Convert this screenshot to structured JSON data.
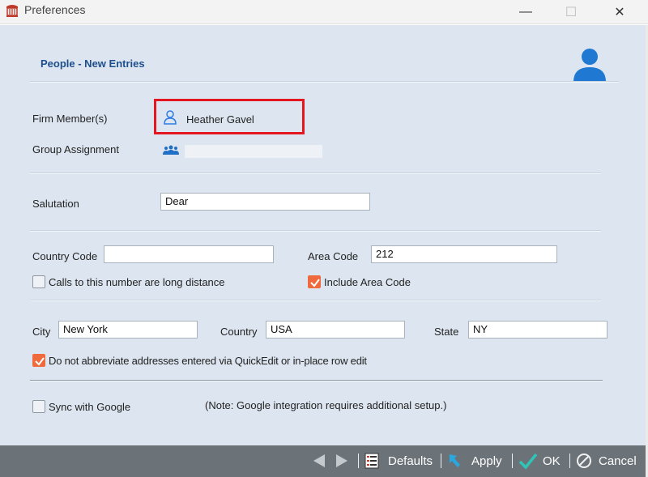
{
  "window": {
    "title": "Preferences",
    "minimize": "—",
    "maximize": "☐",
    "close": "✕"
  },
  "section": {
    "title": "People - New Entries"
  },
  "firm_member": {
    "label": "Firm Member(s)",
    "value": "Heather Gavel"
  },
  "group_assignment": {
    "label": "Group Assignment",
    "value": ""
  },
  "salutation": {
    "label": "Salutation",
    "value": "Dear"
  },
  "country_code": {
    "label": "Country Code",
    "value": ""
  },
  "area_code": {
    "label": "Area Code",
    "value": "212"
  },
  "long_distance": {
    "label": "Calls to this number are long distance",
    "checked": false
  },
  "include_area_code": {
    "label": "Include Area Code",
    "checked": true
  },
  "city": {
    "label": "City",
    "value": "New York"
  },
  "country": {
    "label": "Country",
    "value": "USA"
  },
  "state": {
    "label": "State",
    "value": "NY"
  },
  "no_abbreviate": {
    "label": "Do not abbreviate addresses entered via QuickEdit or in-place row edit",
    "checked": true
  },
  "sync_google": {
    "label": "Sync with Google",
    "checked": false,
    "note": "(Note: Google integration requires additional setup.)"
  },
  "footer": {
    "defaults": "Defaults",
    "apply": "Apply",
    "ok": "OK",
    "cancel": "Cancel"
  },
  "colors": {
    "accent": "#1e4e8c",
    "check": "#ef6a3d",
    "highlight": "#e3171f",
    "footer_bg": "#6c7378"
  }
}
